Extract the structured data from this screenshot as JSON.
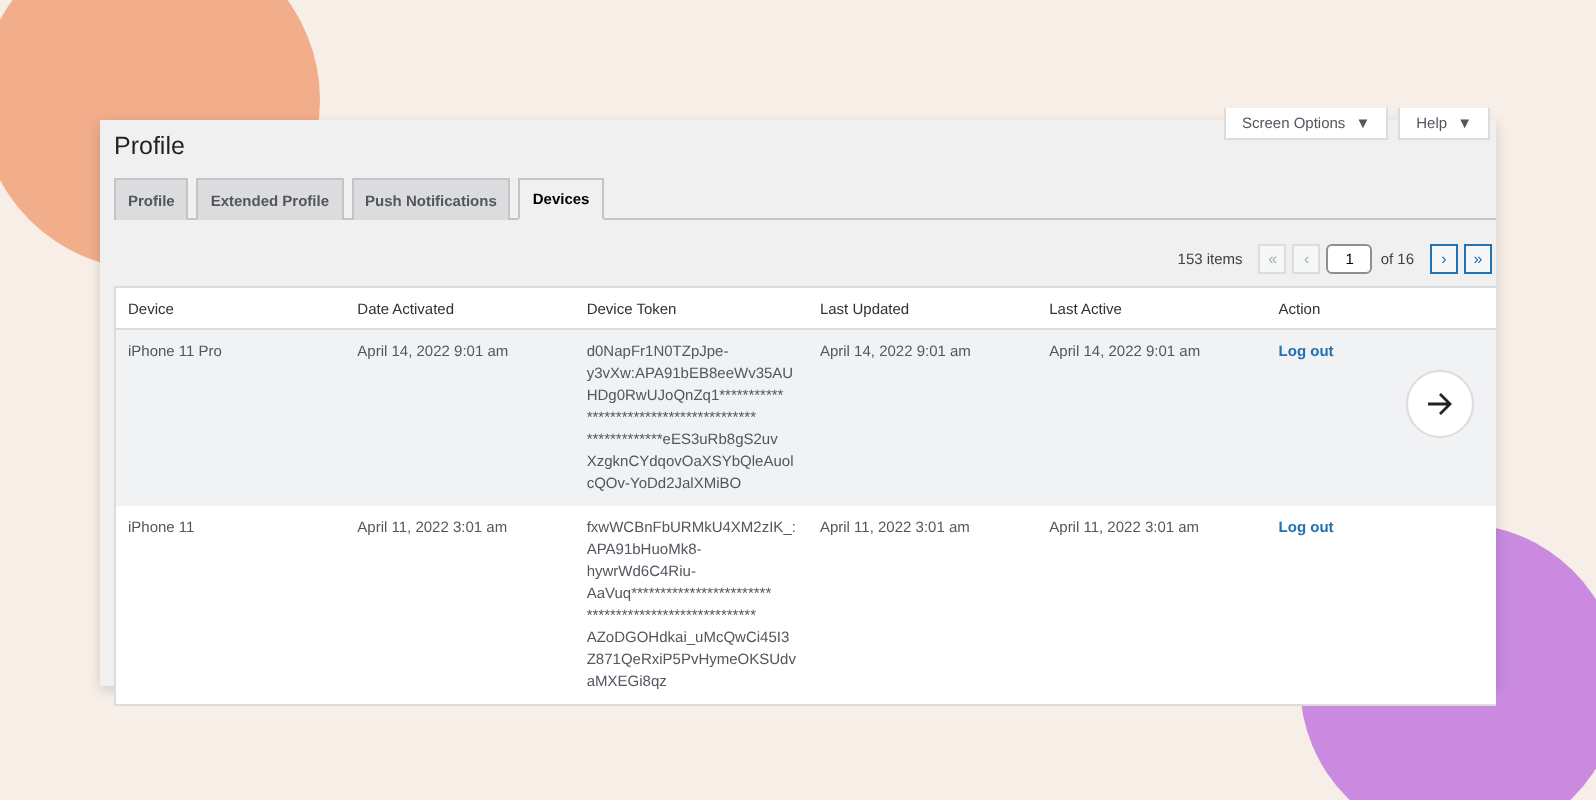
{
  "top_buttons": [
    {
      "label": "Screen Options",
      "caret": "▼"
    },
    {
      "label": "Help",
      "caret": "▼"
    }
  ],
  "title": "Profile",
  "tabs": [
    {
      "label": "Profile",
      "selected": false
    },
    {
      "label": "Extended Profile",
      "selected": false
    },
    {
      "label": "Push Notifications",
      "selected": false
    },
    {
      "label": "Devices",
      "selected": true
    }
  ],
  "pagination": {
    "count": "153 items",
    "buttons_before": [
      {
        "label": "«",
        "disabled": true
      },
      {
        "label": "‹",
        "disabled": true
      }
    ],
    "page": "1",
    "of": "of 16",
    "buttons_after": [
      {
        "label": "›",
        "disabled": false
      },
      {
        "label": "»",
        "disabled": false
      }
    ]
  },
  "table": {
    "columns": [
      "Device",
      "Date Activated",
      "Device Token",
      "Last Updated",
      "Last Active",
      "Action"
    ],
    "rows": [
      {
        "device": "iPhone 11 Pro",
        "date_activated": "April 14, 2022 9:01 am",
        "token": "d0NapFr1N0TZpJpe-\ny3vXw:APA91bEB8eeWv35AU\nHDg0RwUJoQnZq1***********\n*****************************\n*************eES3uRb8gS2uv\nXzgknCYdqovOaXSYbQleAuol\ncQOv-YoDd2JalXMiBO",
        "last_updated": "April 14, 2022 9:01 am",
        "last_active": "April 14, 2022 9:01 am",
        "action": "Log out",
        "selected": true
      },
      {
        "device": "iPhone 11",
        "date_activated": "April 11, 2022 3:01 am",
        "token": "fxwWCBnFbURMkU4XM2zIK_:\nAPA91bHuoMk8-\nhywrWd6C4Riu-\nAaVuq************************\n*****************************\nAZoDGOHdkai_uMcQwCi45I3\nZ871QeRxiP5PvHymeOKSUdv\naMXEGi8qz",
        "last_updated": "April 11, 2022 3:01 am",
        "last_active": "April 11, 2022 3:01 am",
        "action": "Log out",
        "selected": false
      }
    ]
  }
}
